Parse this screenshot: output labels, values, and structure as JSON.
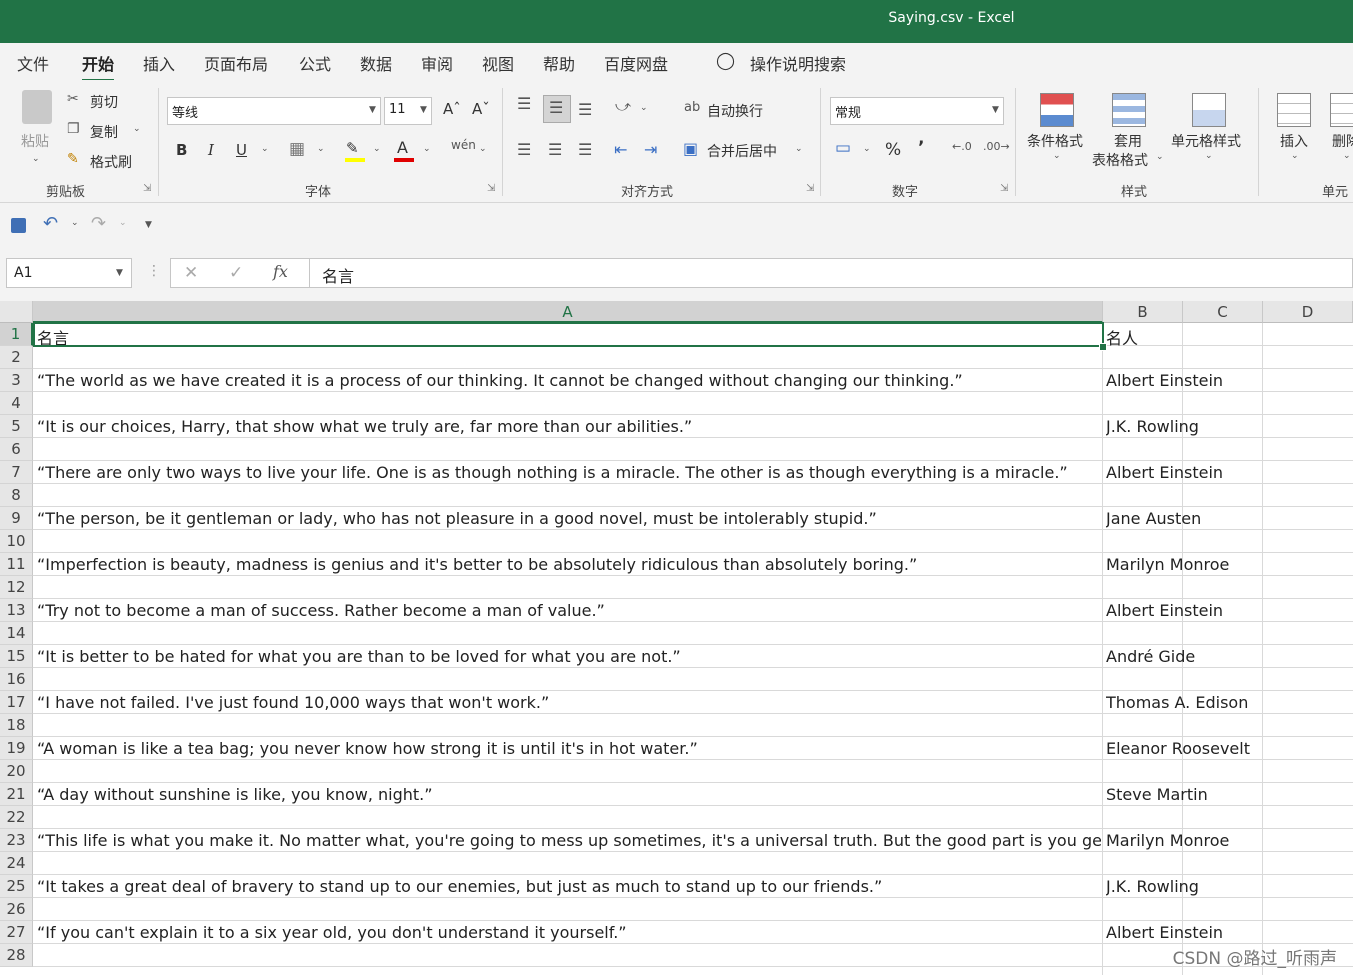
{
  "window": {
    "title": "Saying.csv  -  Excel"
  },
  "menu": [
    "文件",
    "开始",
    "插入",
    "页面布局",
    "公式",
    "数据",
    "审阅",
    "视图",
    "帮助",
    "百度网盘",
    "操作说明搜索"
  ],
  "menu_active": "开始",
  "ribbon": {
    "clipboard": {
      "paste": "粘贴",
      "cut": "剪切",
      "copy": "复制",
      "format_painter": "格式刷",
      "label": "剪贴板"
    },
    "font": {
      "name": "等线",
      "size": "11",
      "bold": "B",
      "italic": "I",
      "underline": "U",
      "label": "字体"
    },
    "alignment": {
      "wrap": "自动换行",
      "merge": "合并后居中",
      "label": "对齐方式"
    },
    "number": {
      "format": "常规",
      "percent": "%",
      "comma": "’",
      "label": "数字"
    },
    "styles": {
      "conditional": "条件格式",
      "table_line1": "套用",
      "table_line2": "表格格式",
      "cell_styles": "单元格样式",
      "label": "样式"
    },
    "cells": {
      "insert": "插入",
      "delete": "删除",
      "label": "单元"
    }
  },
  "formula_bar": {
    "name_box": "A1",
    "fx": "fx",
    "formula": "名言"
  },
  "columns": [
    "A",
    "B",
    "C",
    "D"
  ],
  "rows": [
    {
      "n": "1",
      "a": "名言",
      "b": "名人"
    },
    {
      "n": "2",
      "a": "",
      "b": ""
    },
    {
      "n": "3",
      "a": "“The world as we have created it is a process of our thinking. It cannot be changed without changing our thinking.”",
      "b": "Albert Einstein"
    },
    {
      "n": "4",
      "a": "",
      "b": ""
    },
    {
      "n": "5",
      "a": "“It is our choices, Harry, that show what we truly are, far more than our abilities.”",
      "b": "J.K. Rowling"
    },
    {
      "n": "6",
      "a": "",
      "b": ""
    },
    {
      "n": "7",
      "a": "“There are only two ways to live your life. One is as though nothing is a miracle. The other is as though everything is a miracle.”",
      "b": "Albert Einstein"
    },
    {
      "n": "8",
      "a": "",
      "b": ""
    },
    {
      "n": "9",
      "a": "“The person, be it gentleman or lady, who has not pleasure in a good novel, must be intolerably stupid.”",
      "b": "Jane Austen"
    },
    {
      "n": "10",
      "a": "",
      "b": ""
    },
    {
      "n": "11",
      "a": "“Imperfection is beauty, madness is genius and it's better to be absolutely ridiculous than absolutely boring.”",
      "b": "Marilyn Monroe"
    },
    {
      "n": "12",
      "a": "",
      "b": ""
    },
    {
      "n": "13",
      "a": "“Try not to become a man of success. Rather become a man of value.”",
      "b": "Albert Einstein"
    },
    {
      "n": "14",
      "a": "",
      "b": ""
    },
    {
      "n": "15",
      "a": "“It is better to be hated for what you are than to be loved for what you are not.”",
      "b": "André Gide"
    },
    {
      "n": "16",
      "a": "",
      "b": ""
    },
    {
      "n": "17",
      "a": "“I have not failed. I've just found 10,000 ways that won't work.”",
      "b": "Thomas A. Edison"
    },
    {
      "n": "18",
      "a": "",
      "b": ""
    },
    {
      "n": "19",
      "a": "“A woman is like a tea bag; you never know how strong it is until it's in hot water.”",
      "b": "Eleanor Roosevelt"
    },
    {
      "n": "20",
      "a": "",
      "b": ""
    },
    {
      "n": "21",
      "a": "“A day without sunshine is like, you know, night.”",
      "b": "Steve Martin"
    },
    {
      "n": "22",
      "a": "",
      "b": ""
    },
    {
      "n": "23",
      "a": "“This life is what you make it. No matter what, you're going to mess up sometimes, it's a universal truth. But the good part is you get to dec",
      "b": "Marilyn Monroe"
    },
    {
      "n": "24",
      "a": "",
      "b": ""
    },
    {
      "n": "25",
      "a": "“It takes a great deal of bravery to stand up to our enemies, but just as much to stand up to our friends.”",
      "b": "J.K. Rowling"
    },
    {
      "n": "26",
      "a": "",
      "b": ""
    },
    {
      "n": "27",
      "a": "“If you can't explain it to a six year old, you don't understand it yourself.”",
      "b": "Albert Einstein"
    },
    {
      "n": "28",
      "a": "",
      "b": ""
    }
  ],
  "watermark": "CSDN @路过_听雨声",
  "colors": {
    "accent": "#217346"
  }
}
